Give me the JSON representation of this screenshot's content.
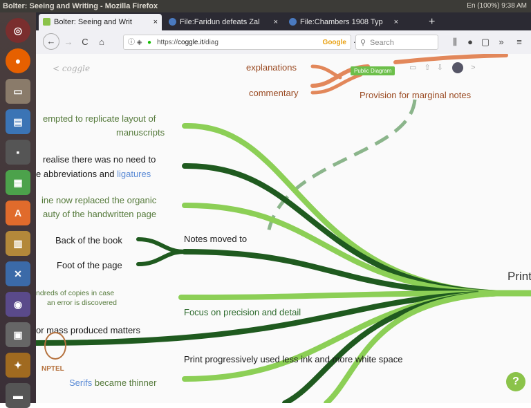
{
  "window": {
    "title": "Bolter: Seeing and Writing - Mozilla Firefox",
    "status": "En  (100%)  9:38 AM"
  },
  "tabs": [
    {
      "label": "Bolter: Seeing and Writ",
      "close": "×"
    },
    {
      "label": "File:Faridun defeats Zal",
      "close": "×"
    },
    {
      "label": "File:Chambers 1908 Typ",
      "close": "×"
    }
  ],
  "new_tab": "+",
  "nav": {
    "back": "←",
    "forward": "→",
    "reload": "C",
    "home": "⌂",
    "url_prefix": "https://",
    "url_domain": "coggle.it",
    "url_rest": "/diag",
    "google_badge": "Google",
    "more": "···",
    "search_placeholder": "Search",
    "overflow": "»",
    "menu": "≡"
  },
  "coggle": {
    "brand": "< coggle",
    "public_badge": "Public Diagram",
    "help": "?"
  },
  "nptel": "NPTEL",
  "nodes": {
    "explanations": "explanations",
    "commentary": "commentary",
    "marginal": "Provision for marginal notes",
    "attempted_1": "empted to replicate layout of",
    "attempted_2": "manuscripts",
    "realise_1": "realise there was no need to",
    "realise_2a": "e abbreviations and ",
    "realise_2b": "ligatures",
    "machine_1": "ine now replaced the organic",
    "machine_2": "auty of the handwritten page",
    "back_of_book": "Back of the book",
    "foot_of_page": "Foot of the page",
    "notes_moved": "Notes moved to",
    "copies_1": "ndreds of copies in case",
    "copies_2": "an error is discovered",
    "precision": "Focus on precision and detail",
    "mass": "or mass produced matters",
    "less_ink": "Print progressively used less ink and more white space",
    "serifs_a": "Serifs",
    "serifs_b": " became thinner",
    "print": "Print"
  }
}
